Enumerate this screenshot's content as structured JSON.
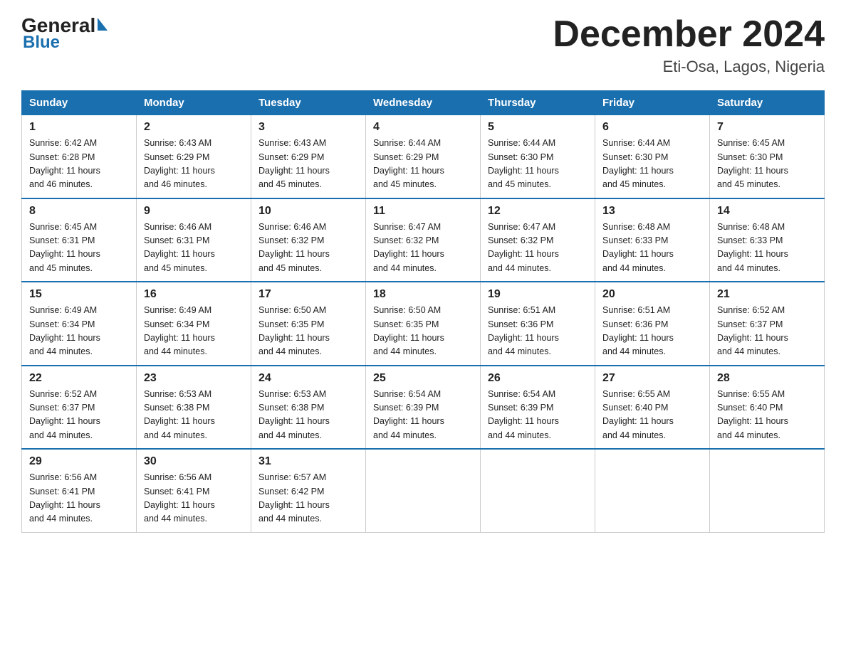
{
  "logo": {
    "text_general": "General",
    "text_blue": "Blue"
  },
  "title": "December 2024",
  "subtitle": "Eti-Osa, Lagos, Nigeria",
  "columns": [
    "Sunday",
    "Monday",
    "Tuesday",
    "Wednesday",
    "Thursday",
    "Friday",
    "Saturday"
  ],
  "weeks": [
    [
      {
        "day": "1",
        "sunrise": "6:42 AM",
        "sunset": "6:28 PM",
        "daylight": "11 hours and 46 minutes."
      },
      {
        "day": "2",
        "sunrise": "6:43 AM",
        "sunset": "6:29 PM",
        "daylight": "11 hours and 46 minutes."
      },
      {
        "day": "3",
        "sunrise": "6:43 AM",
        "sunset": "6:29 PM",
        "daylight": "11 hours and 45 minutes."
      },
      {
        "day": "4",
        "sunrise": "6:44 AM",
        "sunset": "6:29 PM",
        "daylight": "11 hours and 45 minutes."
      },
      {
        "day": "5",
        "sunrise": "6:44 AM",
        "sunset": "6:30 PM",
        "daylight": "11 hours and 45 minutes."
      },
      {
        "day": "6",
        "sunrise": "6:44 AM",
        "sunset": "6:30 PM",
        "daylight": "11 hours and 45 minutes."
      },
      {
        "day": "7",
        "sunrise": "6:45 AM",
        "sunset": "6:30 PM",
        "daylight": "11 hours and 45 minutes."
      }
    ],
    [
      {
        "day": "8",
        "sunrise": "6:45 AM",
        "sunset": "6:31 PM",
        "daylight": "11 hours and 45 minutes."
      },
      {
        "day": "9",
        "sunrise": "6:46 AM",
        "sunset": "6:31 PM",
        "daylight": "11 hours and 45 minutes."
      },
      {
        "day": "10",
        "sunrise": "6:46 AM",
        "sunset": "6:32 PM",
        "daylight": "11 hours and 45 minutes."
      },
      {
        "day": "11",
        "sunrise": "6:47 AM",
        "sunset": "6:32 PM",
        "daylight": "11 hours and 44 minutes."
      },
      {
        "day": "12",
        "sunrise": "6:47 AM",
        "sunset": "6:32 PM",
        "daylight": "11 hours and 44 minutes."
      },
      {
        "day": "13",
        "sunrise": "6:48 AM",
        "sunset": "6:33 PM",
        "daylight": "11 hours and 44 minutes."
      },
      {
        "day": "14",
        "sunrise": "6:48 AM",
        "sunset": "6:33 PM",
        "daylight": "11 hours and 44 minutes."
      }
    ],
    [
      {
        "day": "15",
        "sunrise": "6:49 AM",
        "sunset": "6:34 PM",
        "daylight": "11 hours and 44 minutes."
      },
      {
        "day": "16",
        "sunrise": "6:49 AM",
        "sunset": "6:34 PM",
        "daylight": "11 hours and 44 minutes."
      },
      {
        "day": "17",
        "sunrise": "6:50 AM",
        "sunset": "6:35 PM",
        "daylight": "11 hours and 44 minutes."
      },
      {
        "day": "18",
        "sunrise": "6:50 AM",
        "sunset": "6:35 PM",
        "daylight": "11 hours and 44 minutes."
      },
      {
        "day": "19",
        "sunrise": "6:51 AM",
        "sunset": "6:36 PM",
        "daylight": "11 hours and 44 minutes."
      },
      {
        "day": "20",
        "sunrise": "6:51 AM",
        "sunset": "6:36 PM",
        "daylight": "11 hours and 44 minutes."
      },
      {
        "day": "21",
        "sunrise": "6:52 AM",
        "sunset": "6:37 PM",
        "daylight": "11 hours and 44 minutes."
      }
    ],
    [
      {
        "day": "22",
        "sunrise": "6:52 AM",
        "sunset": "6:37 PM",
        "daylight": "11 hours and 44 minutes."
      },
      {
        "day": "23",
        "sunrise": "6:53 AM",
        "sunset": "6:38 PM",
        "daylight": "11 hours and 44 minutes."
      },
      {
        "day": "24",
        "sunrise": "6:53 AM",
        "sunset": "6:38 PM",
        "daylight": "11 hours and 44 minutes."
      },
      {
        "day": "25",
        "sunrise": "6:54 AM",
        "sunset": "6:39 PM",
        "daylight": "11 hours and 44 minutes."
      },
      {
        "day": "26",
        "sunrise": "6:54 AM",
        "sunset": "6:39 PM",
        "daylight": "11 hours and 44 minutes."
      },
      {
        "day": "27",
        "sunrise": "6:55 AM",
        "sunset": "6:40 PM",
        "daylight": "11 hours and 44 minutes."
      },
      {
        "day": "28",
        "sunrise": "6:55 AM",
        "sunset": "6:40 PM",
        "daylight": "11 hours and 44 minutes."
      }
    ],
    [
      {
        "day": "29",
        "sunrise": "6:56 AM",
        "sunset": "6:41 PM",
        "daylight": "11 hours and 44 minutes."
      },
      {
        "day": "30",
        "sunrise": "6:56 AM",
        "sunset": "6:41 PM",
        "daylight": "11 hours and 44 minutes."
      },
      {
        "day": "31",
        "sunrise": "6:57 AM",
        "sunset": "6:42 PM",
        "daylight": "11 hours and 44 minutes."
      },
      null,
      null,
      null,
      null
    ]
  ],
  "labels": {
    "sunrise": "Sunrise:",
    "sunset": "Sunset:",
    "daylight": "Daylight:"
  }
}
